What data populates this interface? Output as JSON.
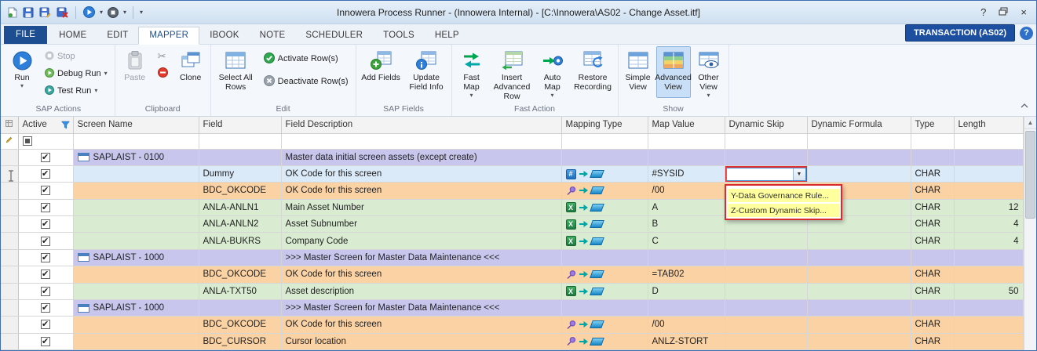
{
  "window": {
    "title": "Innowera Process Runner - (Innowera Internal) - [C:\\Innowera\\AS02 - Change Asset.itf]"
  },
  "icons": {
    "caret": "▾",
    "dropdown_arrow": "▼",
    "close": "×",
    "help": "?",
    "scroll_up": "▲",
    "scissors": "✂"
  },
  "tabs": {
    "items": [
      "FILE",
      "HOME",
      "EDIT",
      "MAPPER",
      "IBOOK",
      "NOTE",
      "SCHEDULER",
      "TOOLS",
      "HELP"
    ],
    "active": "MAPPER"
  },
  "transaction": {
    "label": "TRANSACTION (AS02)"
  },
  "ribbon": {
    "groups": [
      {
        "name": "SAP Actions",
        "buttons": [
          {
            "label": "Run",
            "dropdown": true
          },
          {
            "label": "Stop",
            "disabled": true
          },
          {
            "label": "Debug Run",
            "dropdown": true
          },
          {
            "label": "Test Run",
            "dropdown": true
          }
        ]
      },
      {
        "name": "Clipboard",
        "buttons": [
          {
            "label": "Paste",
            "disabled": true
          },
          {
            "label": "Clone"
          }
        ]
      },
      {
        "name": "Edit",
        "buttons": [
          {
            "label": "Select All Rows"
          },
          {
            "label": "Activate Row(s)"
          },
          {
            "label": "Deactivate Row(s)"
          }
        ]
      },
      {
        "name": "SAP Fields",
        "buttons": [
          {
            "label": "Add Fields"
          },
          {
            "label": "Update Field Info"
          }
        ]
      },
      {
        "name": "Fast Action",
        "buttons": [
          {
            "label": "Fast Map",
            "dropdown": true
          },
          {
            "label": "Insert Advanced Row"
          },
          {
            "label": "Auto Map",
            "dropdown": true
          },
          {
            "label": "Restore Recording"
          }
        ]
      },
      {
        "name": "Show",
        "buttons": [
          {
            "label": "Simple View"
          },
          {
            "label": "Advanced View",
            "selected": true
          },
          {
            "label": "Other View",
            "dropdown": true
          }
        ]
      }
    ]
  },
  "grid": {
    "columns": [
      "Active",
      "Screen Name",
      "Field",
      "Field Description",
      "Mapping Type",
      "Map Value",
      "Dynamic Skip",
      "Dynamic Formula",
      "Type",
      "Length"
    ],
    "rows": [
      {
        "kind": "group",
        "screen": "SAPLAIST - 0100",
        "desc": "Master data initial screen assets (except create)"
      },
      {
        "kind": "data",
        "variant": "blue",
        "field": "Dummy",
        "desc": "OK Code for this screen",
        "icon": "hash",
        "value": "#SYSID",
        "type": "CHAR",
        "length": "",
        "dropdown": true
      },
      {
        "kind": "data",
        "variant": "orange",
        "field": "BDC_OKCODE",
        "desc": "OK Code for this screen",
        "icon": "pin",
        "value": "/00",
        "type": "CHAR",
        "length": ""
      },
      {
        "kind": "data",
        "variant": "green",
        "field": "ANLA-ANLN1",
        "desc": "Main Asset Number",
        "icon": "excel",
        "value": "A",
        "type": "CHAR",
        "length": "12"
      },
      {
        "kind": "data",
        "variant": "green",
        "field": "ANLA-ANLN2",
        "desc": "Asset Subnumber",
        "icon": "excel",
        "value": "B",
        "type": "CHAR",
        "length": "4"
      },
      {
        "kind": "data",
        "variant": "green",
        "field": "ANLA-BUKRS",
        "desc": "Company Code",
        "icon": "excel",
        "value": "C",
        "type": "CHAR",
        "length": "4"
      },
      {
        "kind": "group",
        "screen": "SAPLAIST - 1000",
        "desc": ">>> Master Screen for Master Data Maintenance <<<"
      },
      {
        "kind": "data",
        "variant": "orange",
        "field": "BDC_OKCODE",
        "desc": "OK Code for this screen",
        "icon": "pin",
        "value": "=TAB02",
        "type": "CHAR",
        "length": ""
      },
      {
        "kind": "data",
        "variant": "green",
        "field": "ANLA-TXT50",
        "desc": "Asset description",
        "icon": "excel",
        "value": "D",
        "type": "CHAR",
        "length": "50"
      },
      {
        "kind": "group",
        "screen": "SAPLAIST - 1000",
        "desc": ">>> Master Screen for Master Data Maintenance <<<"
      },
      {
        "kind": "data",
        "variant": "orange",
        "field": "BDC_OKCODE",
        "desc": "OK Code for this screen",
        "icon": "pin",
        "value": "/00",
        "type": "CHAR",
        "length": ""
      },
      {
        "kind": "data",
        "variant": "orange",
        "field": "BDC_CURSOR",
        "desc": "Cursor location",
        "icon": "pin",
        "value": "ANLZ-STORT",
        "type": "CHAR",
        "length": ""
      }
    ]
  },
  "dropdown": {
    "items": [
      "Y-Data Governance Rule...",
      "Z-Custom Dynamic Skip..."
    ]
  }
}
